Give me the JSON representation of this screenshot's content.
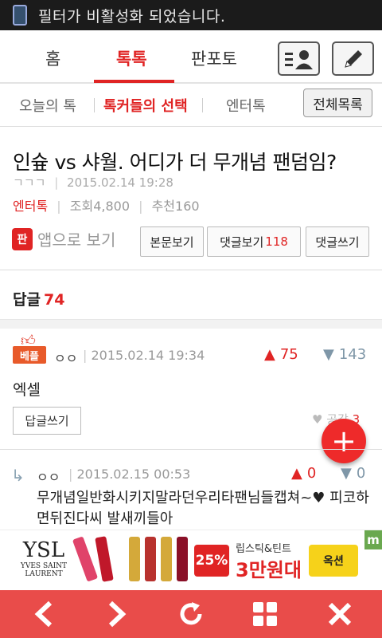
{
  "status_bar": {
    "message": "필터가 비활성화 되었습니다."
  },
  "top_tabs": [
    {
      "label": "홈",
      "active": false
    },
    {
      "label": "톡톡",
      "active": true
    },
    {
      "label": "판포토",
      "active": false
    }
  ],
  "top_icons": {
    "profile": "profile-list-icon",
    "write": "pencil-icon"
  },
  "sub_tabs": [
    {
      "label": "오늘의 톡",
      "active": false
    },
    {
      "label": "톡커들의 선택",
      "active": true
    },
    {
      "label": "엔터톡",
      "active": false
    }
  ],
  "all_list_label": "전체목록",
  "post": {
    "title": "인슢 vs 샤월. 어디가 더 무개념 팬덤임?",
    "author": "ㄱㄱㄱ",
    "datetime": "2015.02.14 19:28",
    "category": "엔터톡",
    "views": "조회4,800",
    "recommends": "추천160"
  },
  "actions": {
    "app_label": "앱으로 보기",
    "view_body": "본문보기",
    "view_comments": "댓글보기",
    "comment_count": "118",
    "write_comment": "댓글쓰기"
  },
  "replies_header": {
    "label": "답글",
    "count": "74"
  },
  "comment1": {
    "badge": "베플",
    "user": "ㅇㅇ",
    "datetime": "2015.02.14 19:34",
    "likes": "75",
    "dislikes": "143",
    "text": "엑셀",
    "reply_label": "답글쓰기",
    "empathy_label": "공감",
    "empathy_count": "3"
  },
  "comment2": {
    "user": "ㅇㅇ",
    "datetime": "2015.02.15 00:53",
    "likes": "0",
    "dislikes": "0",
    "text": "무개념일반화시키지말라던우리타팬님들캡쳐~♥ 피코하면뒤진다씨 발새끼들아"
  },
  "ad": {
    "brand": "YVES SAINT LAURENT",
    "discount": "25%",
    "line1": "립스틱&틴트",
    "line2": "3만원대",
    "shop": "옥션",
    "corner": "m"
  },
  "bottom_bar": [
    "back-icon",
    "forward-icon",
    "refresh-icon",
    "grid-icon",
    "close-icon"
  ],
  "colors": {
    "accent": "#e02424",
    "bottom_bar": "#e94c4a",
    "fab": "#ee2a2a"
  }
}
